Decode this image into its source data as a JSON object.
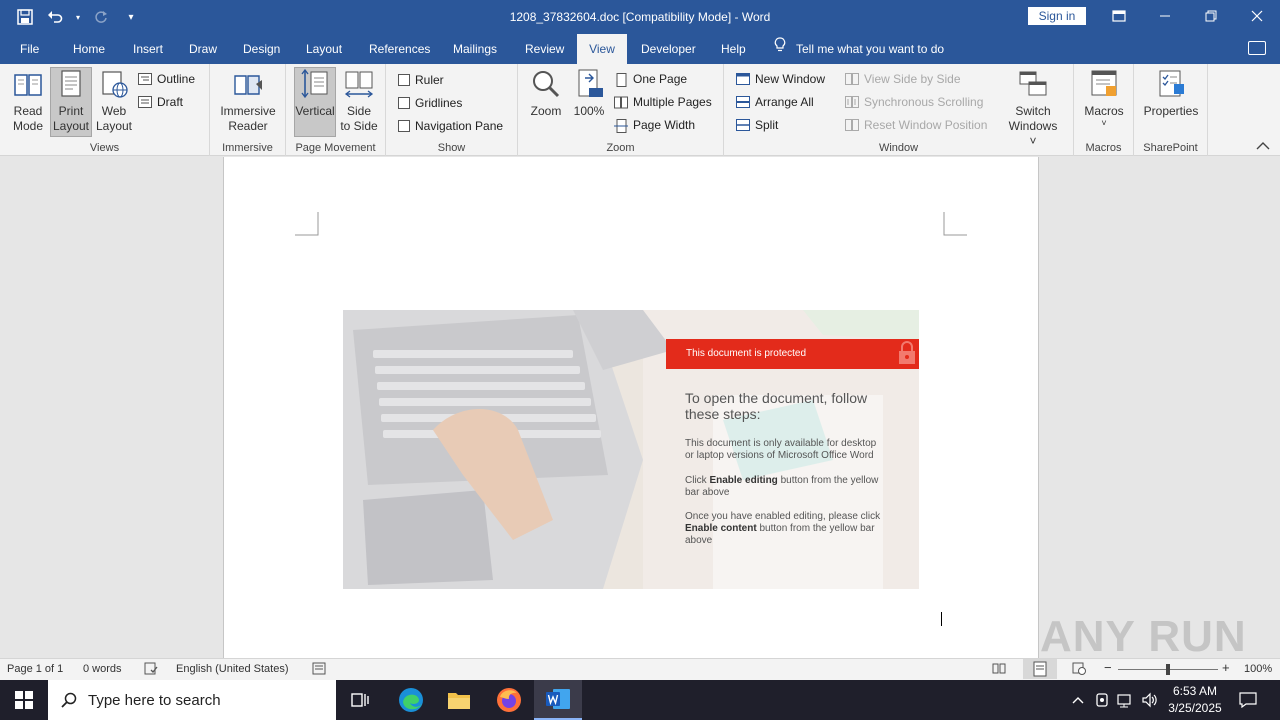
{
  "titlebar": {
    "title": "1208_37832604.doc [Compatibility Mode]  -  Word",
    "signin": "Sign in"
  },
  "tabs": [
    "File",
    "Home",
    "Insert",
    "Draw",
    "Design",
    "Layout",
    "References",
    "Mailings",
    "Review",
    "View",
    "Developer",
    "Help"
  ],
  "active_tab": "View",
  "tellme": "Tell me what you want to do",
  "ribbon": {
    "views": {
      "label": "Views",
      "read_mode": [
        "Read",
        "Mode"
      ],
      "print_layout": [
        "Print",
        "Layout"
      ],
      "web_layout": [
        "Web",
        "Layout"
      ],
      "outline": "Outline",
      "draft": "Draft"
    },
    "immersive": {
      "label": "Immersive",
      "reader": [
        "Immersive",
        "Reader"
      ]
    },
    "page_movement": {
      "label": "Page Movement",
      "vertical": "Vertical",
      "side": [
        "Side",
        "to Side"
      ]
    },
    "show": {
      "label": "Show",
      "ruler": "Ruler",
      "gridlines": "Gridlines",
      "nav_pane": "Navigation Pane"
    },
    "zoom": {
      "label": "Zoom",
      "zoom": "Zoom",
      "hundred": "100%",
      "one_page": "One Page",
      "multiple_pages": "Multiple Pages",
      "page_width": "Page Width"
    },
    "window": {
      "label": "Window",
      "new_window": "New Window",
      "arrange_all": "Arrange All",
      "split": "Split",
      "view_side": "View Side by Side",
      "sync_scroll": "Synchronous Scrolling",
      "reset_pos": "Reset Window Position",
      "switch": [
        "Switch",
        "Windows ˅"
      ]
    },
    "macros": {
      "label": "Macros",
      "macros": "Macros"
    },
    "sharepoint": {
      "label": "SharePoint",
      "properties": "Properties"
    }
  },
  "document": {
    "banner": "This document is protected",
    "heading": "To open the document, follow these steps:",
    "p1": "This document is only available for desktop or laptop versions of Microsoft Office Word",
    "p2_pre": "Click ",
    "p2_bold": "Enable editing",
    "p2_post": " button from the yellow bar above",
    "p3_pre": "Once you have enabled editing, please click ",
    "p3_bold": "Enable content",
    "p3_post": " button from the yellow bar above",
    "watermark": "ANY RUN"
  },
  "status": {
    "page": "Page 1 of 1",
    "words": "0 words",
    "language": "English (United States)",
    "zoom": "100%"
  },
  "taskbar": {
    "search_placeholder": "Type here to search",
    "time": "6:53 AM",
    "date": "3/25/2025"
  },
  "colors": {
    "word_blue": "#2b579a",
    "banner_red": "#e32b1b"
  }
}
